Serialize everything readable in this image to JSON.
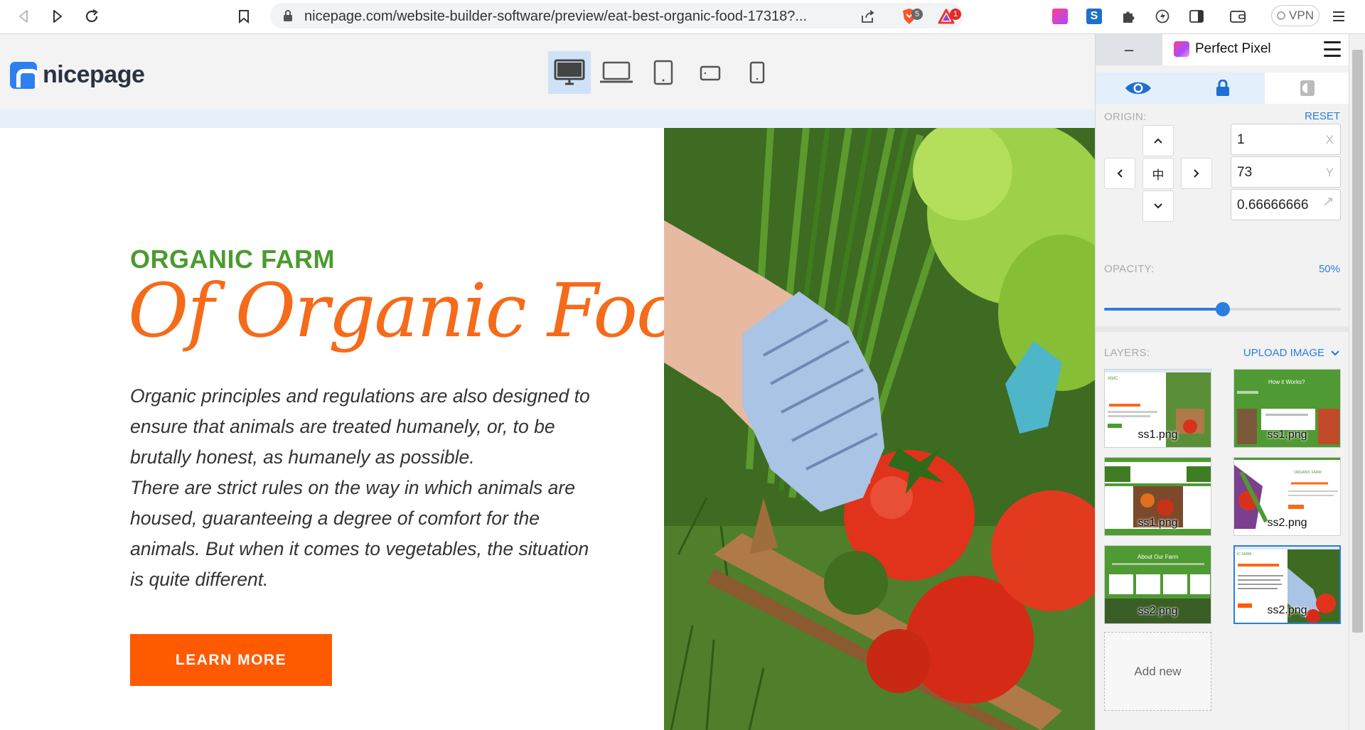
{
  "browser": {
    "url": "nicepage.com/website-builder-software/preview/eat-best-organic-food-17318?...",
    "shields_badge": "5",
    "bat_badge": "1",
    "vpn_label": "VPN"
  },
  "header": {
    "logo_text": "nicepage",
    "devices": [
      "desktop",
      "laptop",
      "tablet",
      "tablet-landscape",
      "phone"
    ],
    "active_device": "desktop"
  },
  "site": {
    "kicker": "ORGANIC FARM",
    "title": "Of Organic Food",
    "paragraph": "Organic principles and regulations are also designed to ensure that animals are treated humanely, or, to be brutally honest, as humanely as possible. There are strict rules on the way in which animals are housed, guaranteeing a degree of comfort for the animals. But when it comes to vegetables, the situation is quite different.",
    "paragraph_lines": [
      "Organic principles and regulations are also designed to",
      "ensure that animals are treated humanely, or, to be",
      "brutally honest, as humanely as possible.",
      "There are strict rules on the way in which animals are",
      "housed, guaranteeing a degree of comfort for the",
      "animals. But when it comes to vegetables, the situation",
      "is quite different."
    ],
    "button_label": "LEARN MORE",
    "colors": {
      "kicker": "#4a9b2f",
      "title": "#f56b1a",
      "button": "#ff5a00"
    }
  },
  "perfect_pixel": {
    "minimize_label": "–",
    "title": "Perfect Pixel",
    "origin_label": "ORIGIN:",
    "reset_label": "RESET",
    "x_value": "1",
    "x_suffix": "X",
    "y_value": "73",
    "y_suffix": "Y",
    "scale_value": "0.66666666",
    "center_glyph": "中",
    "opacity_label": "OPACITY:",
    "opacity_text": "50%",
    "opacity_fraction": 0.5,
    "layers_label": "LAYERS:",
    "upload_label": "UPLOAD IMAGE",
    "layers": [
      {
        "name": "ss1.png",
        "selected": false
      },
      {
        "name": "ss1.png",
        "selected": false
      },
      {
        "name": "ss1.png",
        "selected": false
      },
      {
        "name": "ss2.png",
        "selected": false
      },
      {
        "name": "ss2.png",
        "selected": false
      },
      {
        "name": "ss2.png",
        "selected": true
      }
    ],
    "add_new_label": "Add new",
    "accent": "#2b7de0"
  }
}
